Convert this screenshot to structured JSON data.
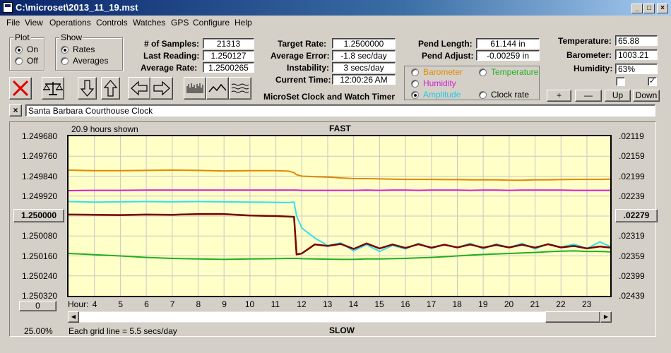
{
  "window": {
    "title": "C:\\microset\\2013_11_19.mst"
  },
  "menu": [
    "File",
    "View",
    "Operations",
    "Controls",
    "Watches",
    "GPS",
    "Configure",
    "Help"
  ],
  "plot_group": {
    "title": "Plot",
    "on": "On",
    "off": "Off",
    "selected": "On"
  },
  "show_group": {
    "title": "Show",
    "rates": "Rates",
    "averages": "Averages",
    "selected": "Rates"
  },
  "stats": {
    "samples_label": "# of Samples:",
    "samples": "21313",
    "last_reading_label": "Last Reading:",
    "last_reading": "1.250127",
    "average_rate_label": "Average Rate:",
    "average_rate": "1.2500265",
    "target_rate_label": "Target Rate:",
    "target_rate": "1.2500000",
    "average_error_label": "Average Error:",
    "average_error": "-1.8 sec/day",
    "instability_label": "Instability:",
    "instability": "3 secs/day",
    "current_time_label": "Current Time:",
    "current_time": "12:00:26 AM",
    "app_name": "MicroSet Clock and Watch Timer"
  },
  "pendulum": {
    "length_label": "Pend Length:",
    "length": "61.144 in",
    "adjust_label": "Pend Adjust:",
    "adjust": "-0.00259 in"
  },
  "sensor_select": {
    "barometer": "Barometer",
    "temperature": "Temperature",
    "humidity": "Humidity",
    "amplitude": "Amplitude",
    "clock_rate": "Clock rate",
    "selected": "Amplitude"
  },
  "environment": {
    "temperature_label": "Temperature:",
    "temperature": "65.88",
    "barometer_label": "Barometer:",
    "barometer": "1003.21",
    "humidity_label": "Humidity:",
    "humidity": "63%",
    "check1": false,
    "check2": true
  },
  "zoom_buttons": {
    "plus": "+",
    "minus": "—",
    "up": "Up",
    "down": "Down"
  },
  "clock_name": "Santa Barbara Courthouse Clock",
  "colors": {
    "barometer": "#e08a00",
    "humidity": "#d020d0",
    "amplitude": "#30e0f0",
    "temperature": "#20b020",
    "clock_rate": "#7a0000",
    "plot_bg": "#ffffc8"
  },
  "chart_data": {
    "type": "line",
    "fast_label": "FAST",
    "slow_label": "SLOW",
    "hours_shown": "20.9 hours shown",
    "hour_label": "Hour:",
    "grid_note": "Each grid line = 5.5 secs/day",
    "percent": "25.00%",
    "offset_button": "0",
    "center_left": "1.250000",
    "center_right": ".02279",
    "left_ticks": [
      "1.249680",
      "1.249760",
      "1.249840",
      "1.249920",
      "1.250000",
      "1.250080",
      "1.250160",
      "1.250240",
      "1.250320"
    ],
    "right_ticks": [
      ".02119",
      ".02159",
      ".02199",
      ".02239",
      ".02279",
      ".02319",
      ".02359",
      ".02399",
      ".02439"
    ],
    "ylim": [
      1.24968,
      1.25032
    ],
    "xlim": [
      3.0,
      23.9
    ],
    "x_ticks": [
      4,
      5,
      6,
      7,
      8,
      9,
      10,
      11,
      12,
      13,
      14,
      15,
      16,
      17,
      18,
      19,
      20,
      21,
      22,
      23
    ],
    "x": [
      3.0,
      4.0,
      5.0,
      6.0,
      7.0,
      8.0,
      9.0,
      10.0,
      11.0,
      11.5,
      11.7,
      11.8,
      12.0,
      12.5,
      13.0,
      13.5,
      14.0,
      14.5,
      15.0,
      15.5,
      16.0,
      16.5,
      17.0,
      17.5,
      18.0,
      18.5,
      19.0,
      19.5,
      20.0,
      20.5,
      21.0,
      21.5,
      22.0,
      22.5,
      23.0,
      23.5,
      23.9
    ],
    "series": [
      {
        "name": "Barometer",
        "color": "#e08a00",
        "values": [
          1.249816,
          1.249818,
          1.249818,
          1.249817,
          1.249816,
          1.249817,
          1.249819,
          1.249818,
          1.249818,
          1.24982,
          1.249826,
          1.249834,
          1.24984,
          1.249842,
          1.249844,
          1.249847,
          1.24985,
          1.24985,
          1.249851,
          1.249852,
          1.249853,
          1.249853,
          1.249853,
          1.249854,
          1.249854,
          1.249855,
          1.249855,
          1.249855,
          1.249856,
          1.249856,
          1.249855,
          1.249855,
          1.249854,
          1.249853,
          1.249853,
          1.249853,
          1.249852
        ]
      },
      {
        "name": "Humidity",
        "color": "#d020d0",
        "values": [
          1.249898,
          1.249897,
          1.249897,
          1.249896,
          1.249896,
          1.249896,
          1.249896,
          1.249896,
          1.249896,
          1.249896,
          1.249896,
          1.249896,
          1.249897,
          1.249897,
          1.249897,
          1.249897,
          1.249897,
          1.249896,
          1.249897,
          1.249896,
          1.249896,
          1.249897,
          1.249896,
          1.249896,
          1.249896,
          1.249897,
          1.249896,
          1.249896,
          1.249897,
          1.249896,
          1.249896,
          1.249896,
          1.249896,
          1.249897,
          1.249897,
          1.249897,
          1.249897
        ]
      },
      {
        "name": "Amplitude",
        "color": "#30e0f0",
        "values": [
          1.249942,
          1.249944,
          1.249943,
          1.249942,
          1.249943,
          1.249942,
          1.249943,
          1.249944,
          1.249945,
          1.249946,
          1.249944,
          1.25,
          1.250048,
          1.250088,
          1.250118,
          1.250108,
          1.25014,
          1.250115,
          1.250142,
          1.250118,
          1.250132,
          1.25011,
          1.25013,
          1.250114,
          1.250126,
          1.25011,
          1.250132,
          1.250112,
          1.250126,
          1.25011,
          1.250132,
          1.250112,
          1.250125,
          1.250113,
          1.25013,
          1.250104,
          1.250122
        ]
      },
      {
        "name": "Clock rate",
        "color": "#7a0000",
        "values": [
          1.249994,
          1.249995,
          1.249996,
          1.249994,
          1.249995,
          1.249992,
          1.249992,
          1.249998,
          1.25,
          1.250002,
          1.250003,
          1.250154,
          1.25015,
          1.250114,
          1.25012,
          1.250112,
          1.250132,
          1.25011,
          1.25013,
          1.250114,
          1.250128,
          1.250113,
          1.250127,
          1.250115,
          1.250126,
          1.250114,
          1.250127,
          1.250116,
          1.250126,
          1.250115,
          1.250127,
          1.250113,
          1.250126,
          1.25012,
          1.25013,
          1.250122,
          1.250127
        ]
      },
      {
        "name": "Temperature",
        "color": "#20b020",
        "values": [
          1.25015,
          1.250155,
          1.25016,
          1.250166,
          1.25017,
          1.250172,
          1.250174,
          1.250172,
          1.250171,
          1.25017,
          1.25017,
          1.25017,
          1.250171,
          1.250172,
          1.250173,
          1.250174,
          1.250174,
          1.250172,
          1.250172,
          1.250171,
          1.25017,
          1.250168,
          1.250166,
          1.250163,
          1.25016,
          1.250157,
          1.250154,
          1.250152,
          1.25015,
          1.250148,
          1.250146,
          1.250143,
          1.250141,
          1.25014,
          1.250142,
          1.250142,
          1.250144
        ]
      }
    ]
  }
}
